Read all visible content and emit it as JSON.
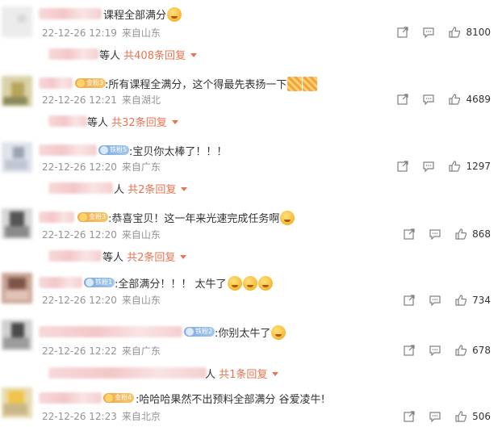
{
  "colors": {
    "accent": "#eb7350",
    "meta": "#939393",
    "text": "#333333"
  },
  "icons": {
    "share": "share-icon",
    "comment": "comment-icon",
    "like": "thumb-up-icon"
  },
  "comments": [
    {
      "text": "课程全部满分",
      "emoji": [
        "crying-laugh"
      ],
      "time": "22-12-26 12:19",
      "location": "来自山东",
      "likes": "8100",
      "reply_prefix": "等人",
      "reply_more": "共408条回复",
      "badge": ""
    },
    {
      "text": ":所有课程全满分，这个得最先表扬一下",
      "emoji": [
        "fireworks",
        "fireworks"
      ],
      "time": "22-12-26 12:21",
      "location": "来自湖北",
      "likes": "4689",
      "reply_prefix": "等人",
      "reply_more": "共32条回复",
      "badge": "金粉3"
    },
    {
      "text": ":宝贝你太棒了！！！",
      "emoji": [],
      "time": "22-12-26 12:20",
      "location": "来自广东",
      "likes": "1297",
      "reply_prefix": "人",
      "reply_more": "共2条回复",
      "badge": "铁粉5"
    },
    {
      "text": ":恭喜宝贝！这一年来光速完成任务啊",
      "emoji": [
        "party"
      ],
      "time": "22-12-26 12:20",
      "location": "来自山东",
      "likes": "868",
      "reply_prefix": "等人",
      "reply_more": "共2条回复",
      "badge": "金粉3"
    },
    {
      "text": ":全部满分！！！ 太牛了",
      "emoji": [
        "party",
        "party",
        "party"
      ],
      "time": "22-12-26 12:20",
      "location": "来自山东",
      "likes": "734",
      "reply_prefix": "",
      "reply_more": "",
      "badge": "铁粉1"
    },
    {
      "text": ":你别太牛了",
      "emoji": [
        "crying-laugh"
      ],
      "time": "22-12-26 12:22",
      "location": "来自广东",
      "likes": "678",
      "reply_prefix": "人",
      "reply_more": "共1条回复",
      "badge": "铁粉2"
    },
    {
      "text": ":哈哈哈果然不出预料全部满分 谷爱凌牛!",
      "emoji": [],
      "time": "22-12-26 12:23",
      "location": "来自北京",
      "likes": "506",
      "reply_prefix": "",
      "reply_more": "",
      "badge": "金粉4"
    }
  ]
}
